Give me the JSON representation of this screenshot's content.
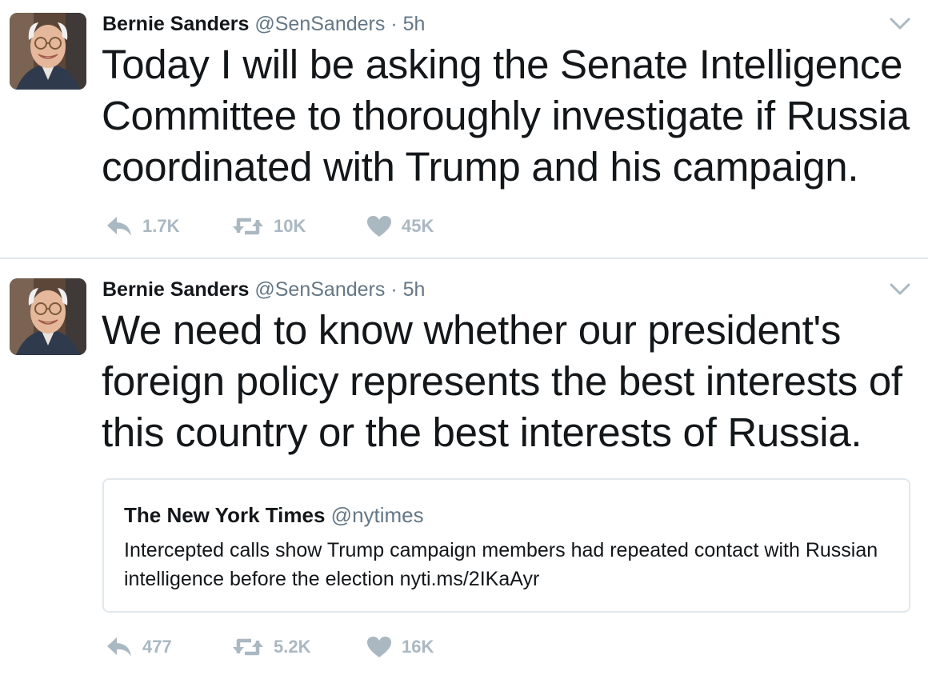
{
  "colors": {
    "primary_text": "#14171a",
    "secondary_text": "#657786",
    "action_gray": "#aab8c2",
    "border": "#e1e8ed"
  },
  "tweets": [
    {
      "author_name": "Bernie Sanders",
      "handle": "@SenSanders",
      "separator": "·",
      "time": "5h",
      "text": "Today I will be asking the Senate Intelligence Committee to thoroughly investigate if Russia coordinated with Trump and his campaign.",
      "replies": "1.7K",
      "retweets": "10K",
      "likes": "45K",
      "icons": [
        "avatar",
        "chevron-down-icon",
        "reply-icon",
        "retweet-icon",
        "heart-icon"
      ]
    },
    {
      "author_name": "Bernie Sanders",
      "handle": "@SenSanders",
      "separator": "·",
      "time": "5h",
      "text": "We need to know whether our president's foreign policy represents the best interests of this country or the best interests of Russia.",
      "quoted": {
        "author_name": "The New York Times",
        "handle": "@nytimes",
        "text": "Intercepted calls show Trump campaign members had repeated contact with Russian intelligence before the election nyti.ms/2IKaAyr"
      },
      "replies": "477",
      "retweets": "5.2K",
      "likes": "16K",
      "icons": [
        "avatar",
        "chevron-down-icon",
        "reply-icon",
        "retweet-icon",
        "heart-icon"
      ]
    }
  ]
}
